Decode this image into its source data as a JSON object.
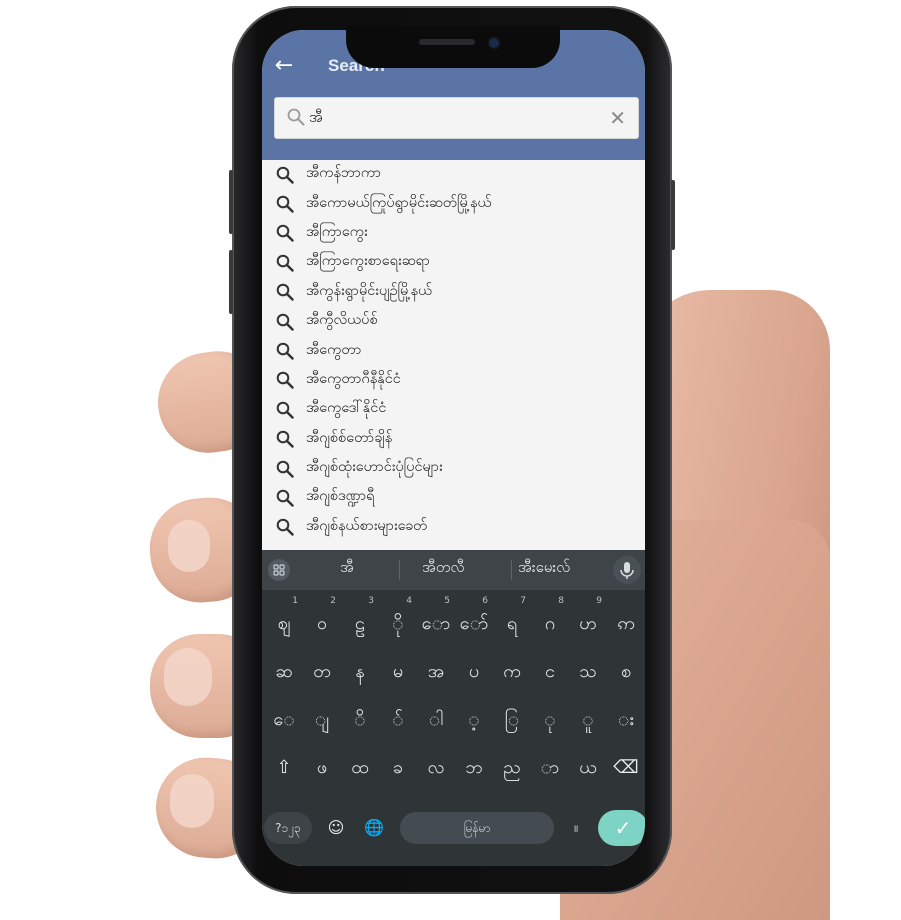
{
  "header": {
    "back_glyph": "←",
    "title": "Search"
  },
  "search": {
    "value": "အီ",
    "clear_glyph": "✕"
  },
  "suggestions": [
    "အီကန်ဘာကာ",
    "အီကောမယ်ကြုပ်ရွာမိုင်းဆတ်မြို့နယ်",
    "အီကြာကွေး",
    "အီကြာကွေးစာရေးဆရာ",
    "အီကွန်းရွာမိုင်းပျဉ်မြို့နယ်",
    "အီကွီလိယပ်စ်",
    "အီကွေတာ",
    "အီကွေတာဂီနီနိုင်ငံ",
    "အီကွေဒေါ်နိုင်ငံ",
    "အီဂျစ်စ်တော်ချိန်",
    "အီဂျစ်ထုံးဟောင်းပုံပြင်များ",
    "အီဂျစ်ဒဏ္ဍာရီ",
    "အီဂျစ်နယ်စားများခေတ်"
  ],
  "keyboard": {
    "suggestion_bar": [
      "အီ",
      "အီတလီ",
      "အီးမေးလ်"
    ],
    "row1": [
      {
        "k": "ဈ",
        "n": "1"
      },
      {
        "k": "ဝ",
        "n": "2"
      },
      {
        "k": "ဠ",
        "n": "3"
      },
      {
        "k": "ို",
        "n": "4"
      },
      {
        "k": "ော",
        "n": "5"
      },
      {
        "k": "ော်",
        "n": "6"
      },
      {
        "k": "ရ",
        "n": "7"
      },
      {
        "k": "ဂ",
        "n": "8"
      },
      {
        "k": "ဟ",
        "n": "9"
      },
      {
        "k": "ဢ",
        "n": ""
      }
    ],
    "row2": [
      "ဆ",
      "တ",
      "န",
      "မ",
      "အ",
      "ပ",
      "က",
      "င",
      "သ",
      "စ"
    ],
    "row3": [
      "ေ",
      "ျ",
      "ိ",
      "်",
      "ါ",
      "့",
      "ြ",
      "ု",
      "ူ",
      "း"
    ],
    "row4": [
      "⇧",
      "ဖ",
      "ထ",
      "ခ",
      "လ",
      "ဘ",
      "ည",
      "ာ",
      "ယ",
      "⌫"
    ],
    "symbols_label": "?၁၂၃",
    "emoji_glyph": "☺",
    "globe_glyph": "🌐",
    "space_label": "မြန်မာ",
    "punct_label": "။",
    "enter_glyph": "✓"
  },
  "colors": {
    "appbar": "#5b74a6",
    "keyboard_bg": "#2f3437",
    "enter_key": "#7dd3c4"
  }
}
